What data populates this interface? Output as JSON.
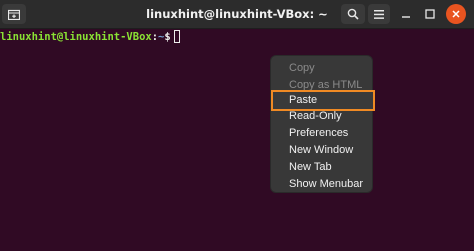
{
  "window": {
    "title": "linuxhint@linuxhint-VBox: ~"
  },
  "titlebar_icons": {
    "new_tab": "new-tab-icon",
    "search": "search-icon",
    "menu": "hamburger-icon",
    "minimize": "minimize-icon",
    "maximize": "maximize-icon",
    "close": "close-icon"
  },
  "colors": {
    "terminal_bg": "#300a24",
    "prompt_user": "#8ae234",
    "prompt_path": "#729fcf",
    "close_button": "#e95420",
    "highlight_outline": "#f08a24"
  },
  "terminal": {
    "prompt_user_host": "linuxhint@linuxhint-VBox",
    "prompt_colon": ":",
    "prompt_path": "~",
    "prompt_symbol": "$"
  },
  "context_menu": {
    "items": [
      {
        "label": "Copy",
        "enabled": false
      },
      {
        "label": "Copy as HTML",
        "enabled": false
      },
      {
        "label": "Paste",
        "enabled": true,
        "highlighted": true
      },
      {
        "label": "Read-Only",
        "enabled": true
      },
      {
        "label": "Preferences",
        "enabled": true
      },
      {
        "label": "New Window",
        "enabled": true
      },
      {
        "label": "New Tab",
        "enabled": true
      },
      {
        "label": "Show Menubar",
        "enabled": true
      }
    ]
  }
}
